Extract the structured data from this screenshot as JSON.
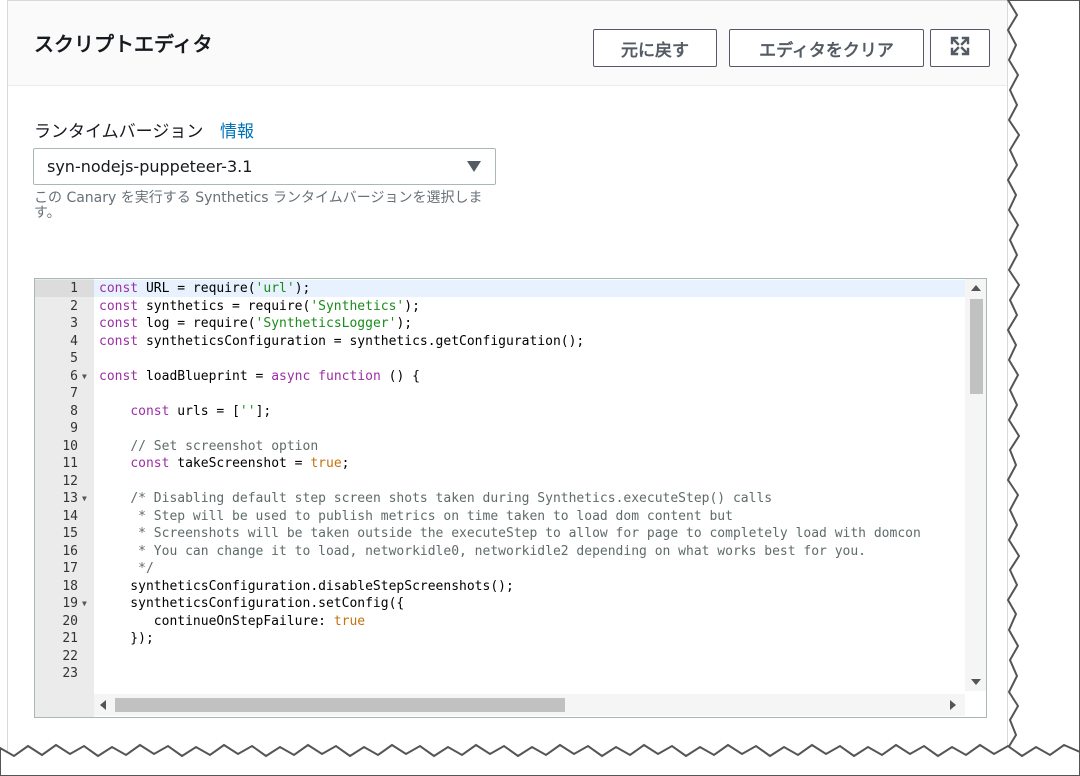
{
  "header": {
    "title": "スクリプトエディタ",
    "undo_label": "元に戻す",
    "clear_label": "エディタをクリア",
    "fullscreen_icon": "expand-icon"
  },
  "runtime": {
    "label": "ランタイムバージョン",
    "info_link": "情報",
    "selected": "syn-nodejs-puppeteer-3.1",
    "hint": "この Canary を実行する Synthetics ランタイムバージョンを選択します。"
  },
  "editor": {
    "active_line": 1,
    "lines": [
      {
        "n": "1",
        "fold": false,
        "html": "<span class='kw'>const</span> URL = require(<span class='str'>'url'</span>);"
      },
      {
        "n": "2",
        "fold": false,
        "html": "<span class='kw'>const</span> synthetics = require(<span class='str'>'Synthetics'</span>);"
      },
      {
        "n": "3",
        "fold": false,
        "html": "<span class='kw'>const</span> log = require(<span class='str'>'SyntheticsLogger'</span>);"
      },
      {
        "n": "4",
        "fold": false,
        "html": "<span class='kw'>const</span> syntheticsConfiguration = synthetics.getConfiguration();"
      },
      {
        "n": "5",
        "fold": false,
        "html": ""
      },
      {
        "n": "6",
        "fold": true,
        "html": "<span class='kw'>const</span> loadBlueprint = <span class='kw'>async</span> <span class='kw'>function</span> () {"
      },
      {
        "n": "7",
        "fold": false,
        "html": ""
      },
      {
        "n": "8",
        "fold": false,
        "html": "    <span class='kw'>const</span> urls = [<span class='str'>''</span>];"
      },
      {
        "n": "9",
        "fold": false,
        "html": ""
      },
      {
        "n": "10",
        "fold": false,
        "html": "    <span class='cm'>// Set screenshot option</span>"
      },
      {
        "n": "11",
        "fold": false,
        "html": "    <span class='kw'>const</span> takeScreenshot = <span class='lit'>true</span>;"
      },
      {
        "n": "12",
        "fold": false,
        "html": ""
      },
      {
        "n": "13",
        "fold": true,
        "html": "    <span class='cm'>/* Disabling default step screen shots taken during Synthetics.executeStep() calls</span>"
      },
      {
        "n": "14",
        "fold": false,
        "html": "<span class='cm'>     * Step will be used to publish metrics on time taken to load dom content but</span>"
      },
      {
        "n": "15",
        "fold": false,
        "html": "<span class='cm'>     * Screenshots will be taken outside the executeStep to allow for page to completely load with domcon</span>"
      },
      {
        "n": "16",
        "fold": false,
        "html": "<span class='cm'>     * You can change it to load, networkidle0, networkidle2 depending on what works best for you.</span>"
      },
      {
        "n": "17",
        "fold": false,
        "html": "<span class='cm'>     */</span>"
      },
      {
        "n": "18",
        "fold": false,
        "html": "    syntheticsConfiguration.disableStepScreenshots();"
      },
      {
        "n": "19",
        "fold": true,
        "html": "    syntheticsConfiguration.setConfig({"
      },
      {
        "n": "20",
        "fold": false,
        "html": "       continueOnStepFailure: <span class='lit'>true</span>"
      },
      {
        "n": "21",
        "fold": false,
        "html": "    });"
      },
      {
        "n": "22",
        "fold": false,
        "html": ""
      },
      {
        "n": "23",
        "fold": false,
        "html": ""
      }
    ]
  },
  "colors": {
    "keyword": "#9b2fa5",
    "string": "#1a8c1a",
    "literal": "#c5720b",
    "comment": "#5f6b6b",
    "link": "#0073bb"
  }
}
